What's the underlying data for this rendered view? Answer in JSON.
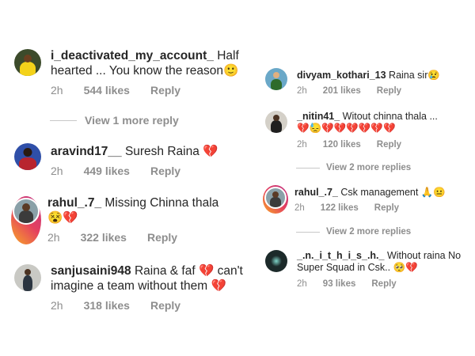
{
  "left_comments": [
    {
      "username": "i_deactivated_my_account_",
      "text": "Half hearted ... You know the reason",
      "emoji": "🙂",
      "time": "2h",
      "likes": "544 likes",
      "reply": "Reply"
    },
    {
      "username": "aravind17__",
      "text": "Suresh Raina",
      "emoji": "💔",
      "time": "2h",
      "likes": "449 likes",
      "reply": "Reply"
    },
    {
      "username": "rahul_.7_",
      "text": "Missing Chinna thala",
      "emoji": "😵💔",
      "time": "2h",
      "likes": "322 likes",
      "reply": "Reply"
    },
    {
      "username": "sanjusaini948",
      "text": "Raina & faf 💔 can't imagine a team without them",
      "emoji": "💔",
      "time": "2h",
      "likes": "318 likes",
      "reply": "Reply"
    }
  ],
  "left_view_more": "View 1 more reply",
  "right_comments": [
    {
      "username": "divyam_kothari_13",
      "text": "Raina sir",
      "emoji": "😢",
      "time": "2h",
      "likes": "201 likes",
      "reply": "Reply"
    },
    {
      "username": "_nitin41_",
      "text": "Witout chinna thala ...",
      "emoji": "💔😓💔💔💔💔💔💔",
      "time": "2h",
      "likes": "120 likes",
      "reply": "Reply"
    },
    {
      "username": "rahul_.7_",
      "text": "Csk management",
      "emoji": "🙏😐",
      "time": "2h",
      "likes": "122 likes",
      "reply": "Reply"
    },
    {
      "username": "_.n._i_t_h_i_s_.h._",
      "text": "Without raina No Super Squad in Csk..",
      "emoji": "🥺💔",
      "time": "2h",
      "likes": "93 likes",
      "reply": "Reply"
    }
  ],
  "right_view_more_1": "View 2 more replies",
  "right_view_more_2": "View 2 more replies",
  "colors": {
    "text": "#262626",
    "muted": "#8e8e8e",
    "heart": "#d81b2a",
    "story_ring_start": "#f9a825",
    "story_ring_end": "#c13584"
  }
}
